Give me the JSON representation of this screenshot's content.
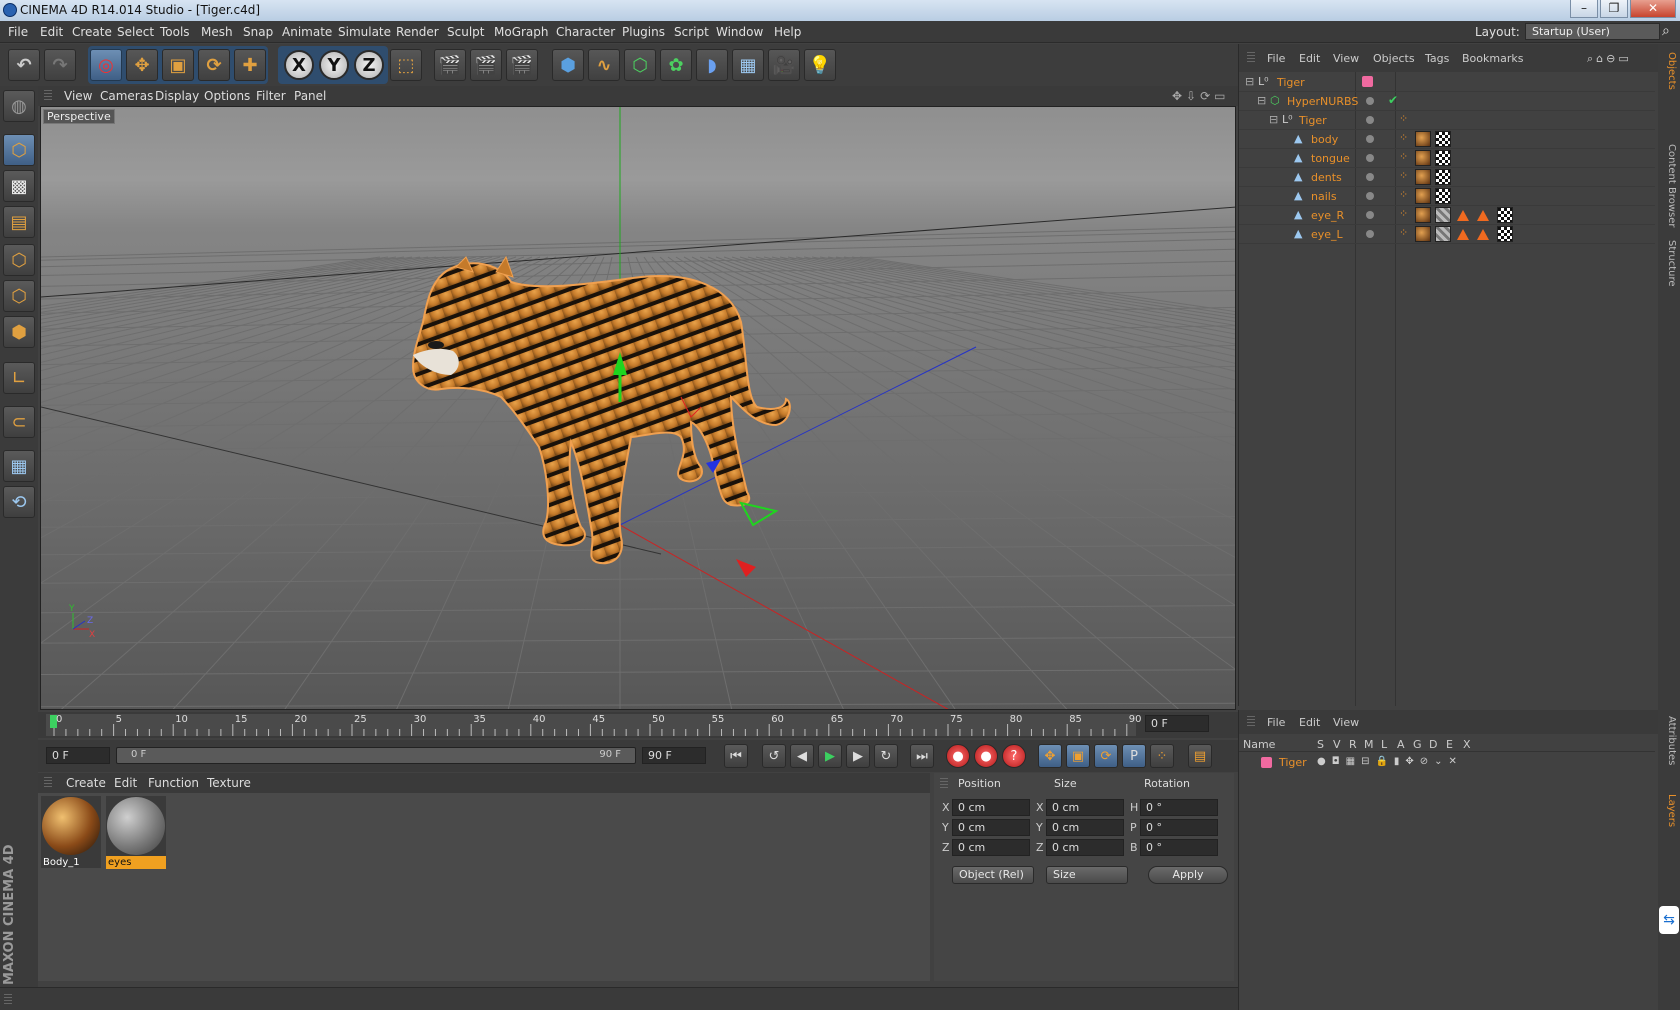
{
  "window": {
    "title": "CINEMA 4D R14.014 Studio - [Tiger.c4d]",
    "minimize": "–",
    "maximize": "❐",
    "close": "✕"
  },
  "menubar": {
    "items": [
      "File",
      "Edit",
      "Create",
      "Select",
      "Tools",
      "Mesh",
      "Snap",
      "Animate",
      "Simulate",
      "Render",
      "Sculpt",
      "MoGraph",
      "Character",
      "Plugins",
      "Script",
      "Window",
      "Help"
    ],
    "layout_label": "Layout:",
    "layout_value": "Startup (User)"
  },
  "viewport": {
    "menu": [
      "View",
      "Cameras",
      "Display",
      "Options",
      "Filter",
      "Panel"
    ],
    "label": "Perspective",
    "axis_y": "Y",
    "axis_z": "Z",
    "axis_x": "X"
  },
  "timeline": {
    "ticks": [
      "0",
      "5",
      "10",
      "15",
      "20",
      "25",
      "30",
      "35",
      "40",
      "45",
      "50",
      "55",
      "60",
      "65",
      "70",
      "75",
      "80",
      "85",
      "90"
    ],
    "current_frame": "0 F"
  },
  "transport": {
    "start_field": "0 F",
    "range_start": "0 F",
    "range_end": "90 F",
    "end_field": "90 F"
  },
  "materials": {
    "menu": [
      "Create",
      "Edit",
      "Function",
      "Texture"
    ],
    "items": [
      {
        "name": "Body_1"
      },
      {
        "name": "eyes"
      }
    ]
  },
  "coordinates": {
    "headers": {
      "position": "Position",
      "size": "Size",
      "rotation": "Rotation"
    },
    "rows": [
      {
        "axis": "X",
        "pos": "0 cm",
        "size_axis": "X",
        "size": "0 cm",
        "rot_axis": "H",
        "rot": "0 °"
      },
      {
        "axis": "Y",
        "pos": "0 cm",
        "size_axis": "Y",
        "size": "0 cm",
        "rot_axis": "P",
        "rot": "0 °"
      },
      {
        "axis": "Z",
        "pos": "0 cm",
        "size_axis": "Z",
        "size": "0 cm",
        "rot_axis": "B",
        "rot": "0 °"
      }
    ],
    "mode_select": "Object (Rel)",
    "size_select": "Size",
    "apply": "Apply"
  },
  "objects": {
    "menu": [
      "File",
      "Edit",
      "View",
      "Objects",
      "Tags",
      "Bookmarks"
    ],
    "tree": [
      {
        "name": "Tiger"
      },
      {
        "name": "HyperNURBS"
      },
      {
        "name": "Tiger"
      },
      {
        "name": "body"
      },
      {
        "name": "tongue"
      },
      {
        "name": "dents"
      },
      {
        "name": "nails"
      },
      {
        "name": "eye_R"
      },
      {
        "name": "eye_L"
      }
    ]
  },
  "layers": {
    "menu": [
      "File",
      "Edit",
      "View"
    ],
    "columns": [
      "Name",
      "S",
      "V",
      "R",
      "M",
      "L",
      "A",
      "G",
      "D",
      "E",
      "X"
    ],
    "rows": [
      {
        "name": "Tiger"
      }
    ]
  },
  "side_tabs": [
    "Objects",
    "Content Browser",
    "Structure",
    "Attributes",
    "Layers"
  ],
  "brand": "MAXON CINEMA 4D",
  "colors": {
    "accent_orange": "#e8902a",
    "selection_blue": "#3f5f86",
    "layer_pink": "#f06aa0"
  }
}
